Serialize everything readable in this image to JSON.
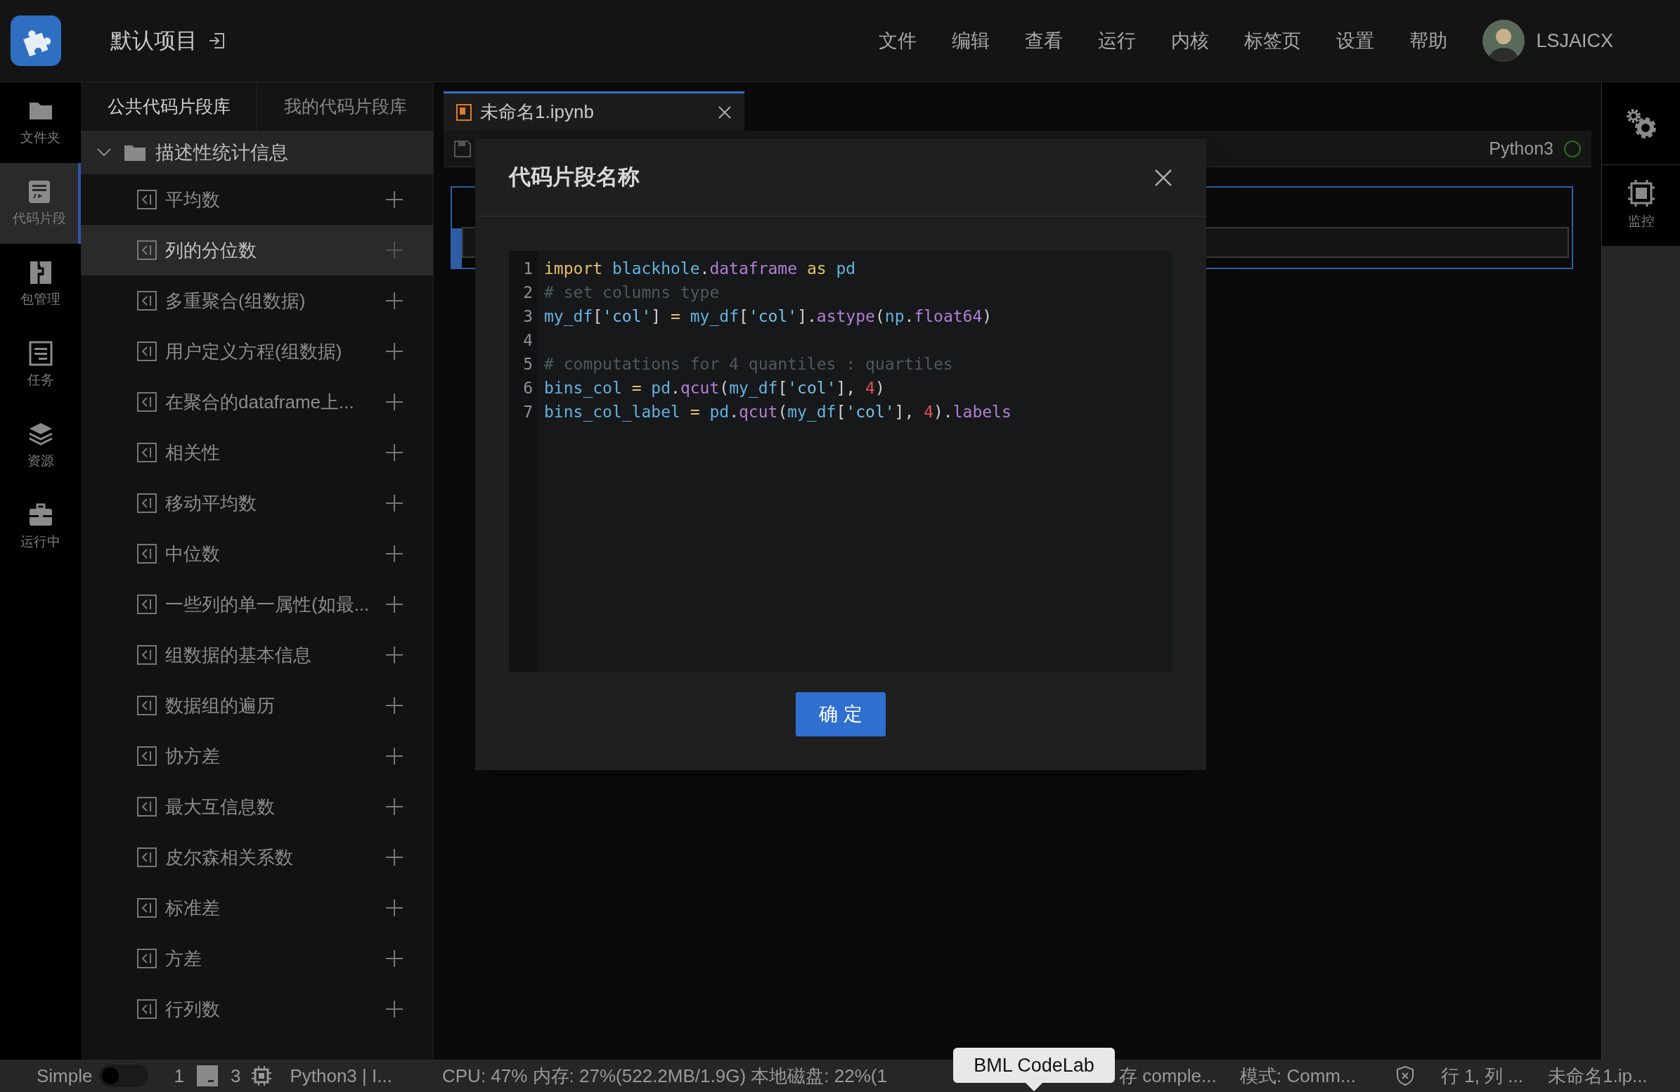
{
  "header": {
    "project": "默认项目",
    "menu": [
      "文件",
      "编辑",
      "查看",
      "运行",
      "内核",
      "标签页",
      "设置",
      "帮助"
    ],
    "user": "LSJAICX"
  },
  "left_rail": [
    {
      "label": "文件夹",
      "selected": false
    },
    {
      "label": "代码片段",
      "selected": true
    },
    {
      "label": "包管理",
      "selected": false
    },
    {
      "label": "任务",
      "selected": false
    },
    {
      "label": "资源",
      "selected": false
    },
    {
      "label": "运行中",
      "selected": false
    }
  ],
  "snippet_panel": {
    "tabs": [
      {
        "label": "公共代码片段库",
        "selected": true
      },
      {
        "label": "我的代码片段库",
        "selected": false
      }
    ],
    "group": {
      "label": "描述性统计信息",
      "expanded": true,
      "children": [
        {
          "label": "平均数",
          "selected": false
        },
        {
          "label": "列的分位数",
          "selected": true
        },
        {
          "label": "多重聚合(组数据)",
          "selected": false
        },
        {
          "label": "用户定义方程(组数据)",
          "selected": false
        },
        {
          "label": "在聚合的dataframe上...",
          "selected": false
        },
        {
          "label": "相关性",
          "selected": false
        },
        {
          "label": "移动平均数",
          "selected": false
        },
        {
          "label": "中位数",
          "selected": false
        },
        {
          "label": "一些列的单一属性(如最...",
          "selected": false
        },
        {
          "label": "组数据的基本信息",
          "selected": false
        },
        {
          "label": "数据组的遍历",
          "selected": false
        },
        {
          "label": "协方差",
          "selected": false
        },
        {
          "label": "最大互信息数",
          "selected": false
        },
        {
          "label": "皮尔森相关系数",
          "selected": false
        },
        {
          "label": "标准差",
          "selected": false
        },
        {
          "label": "方差",
          "selected": false
        },
        {
          "label": "行列数",
          "selected": false
        }
      ]
    }
  },
  "editor": {
    "tab": {
      "title": "未命名1.ipynb",
      "selected": true
    },
    "kernel": "Python3"
  },
  "right_rail": [
    {
      "label": "监控"
    }
  ],
  "dialog": {
    "title": "代码片段名称",
    "code": [
      {
        "number": "1",
        "tokens": [
          {
            "kind": "keyword",
            "text": "import "
          },
          {
            "kind": "name",
            "text": "blackhole"
          },
          {
            "kind": "plain",
            "text": "."
          },
          {
            "kind": "attr",
            "text": "dataframe "
          },
          {
            "kind": "keyword",
            "text": "as "
          },
          {
            "kind": "name",
            "text": "pd"
          }
        ]
      },
      {
        "number": "2",
        "tokens": [
          {
            "kind": "comment",
            "text": "# set columns type"
          }
        ]
      },
      {
        "number": "3",
        "tokens": [
          {
            "kind": "name",
            "text": "my_df"
          },
          {
            "kind": "plain",
            "text": "["
          },
          {
            "kind": "string",
            "text": "'col'"
          },
          {
            "kind": "plain",
            "text": "] "
          },
          {
            "kind": "op",
            "text": "= "
          },
          {
            "kind": "name",
            "text": "my_df"
          },
          {
            "kind": "plain",
            "text": "["
          },
          {
            "kind": "string",
            "text": "'col'"
          },
          {
            "kind": "plain",
            "text": "]."
          },
          {
            "kind": "attr",
            "text": "astype"
          },
          {
            "kind": "plain",
            "text": "("
          },
          {
            "kind": "name",
            "text": "np"
          },
          {
            "kind": "plain",
            "text": "."
          },
          {
            "kind": "attr",
            "text": "float64"
          },
          {
            "kind": "plain",
            "text": ")"
          }
        ]
      },
      {
        "number": "4"
      },
      {
        "number": "5",
        "tokens": [
          {
            "kind": "comment",
            "text": "# computations for 4 quantiles : quartiles"
          }
        ]
      },
      {
        "number": "6",
        "tokens": [
          {
            "kind": "name",
            "text": "bins_col "
          },
          {
            "kind": "op",
            "text": "= "
          },
          {
            "kind": "name",
            "text": "pd"
          },
          {
            "kind": "plain",
            "text": "."
          },
          {
            "kind": "attr",
            "text": "qcut"
          },
          {
            "kind": "plain",
            "text": "("
          },
          {
            "kind": "name",
            "text": "my_df"
          },
          {
            "kind": "plain",
            "text": "["
          },
          {
            "kind": "string",
            "text": "'col'"
          },
          {
            "kind": "plain",
            "text": "], "
          },
          {
            "kind": "number",
            "text": "4"
          },
          {
            "kind": "plain",
            "text": ")"
          }
        ]
      },
      {
        "number": "7",
        "tokens": [
          {
            "kind": "name",
            "text": "bins_col_label "
          },
          {
            "kind": "op",
            "text": "= "
          },
          {
            "kind": "name",
            "text": "pd"
          },
          {
            "kind": "plain",
            "text": "."
          },
          {
            "kind": "attr",
            "text": "qcut"
          },
          {
            "kind": "plain",
            "text": "("
          },
          {
            "kind": "name",
            "text": "my_df"
          },
          {
            "kind": "plain",
            "text": "["
          },
          {
            "kind": "string",
            "text": "'col'"
          },
          {
            "kind": "plain",
            "text": "], "
          },
          {
            "kind": "number",
            "text": "4"
          },
          {
            "kind": "plain",
            "text": ")."
          },
          {
            "kind": "attr",
            "text": "labels"
          }
        ]
      }
    ],
    "confirm": "确 定"
  },
  "status_bar": {
    "mode_label": "Simple",
    "simple_mode": false,
    "count_a": "1",
    "count_b": "3",
    "kernel": "Python3 | I...",
    "resources": "CPU: 47% 内存: 27%(522.2MB/1.9G) 本地磁盘: 22%(1",
    "save_state": "存 comple...",
    "mode": "模式: Comm...",
    "position": "行 1, 列 ...",
    "file": "未命名1.ip...",
    "tooltip": "BML CodeLab"
  }
}
